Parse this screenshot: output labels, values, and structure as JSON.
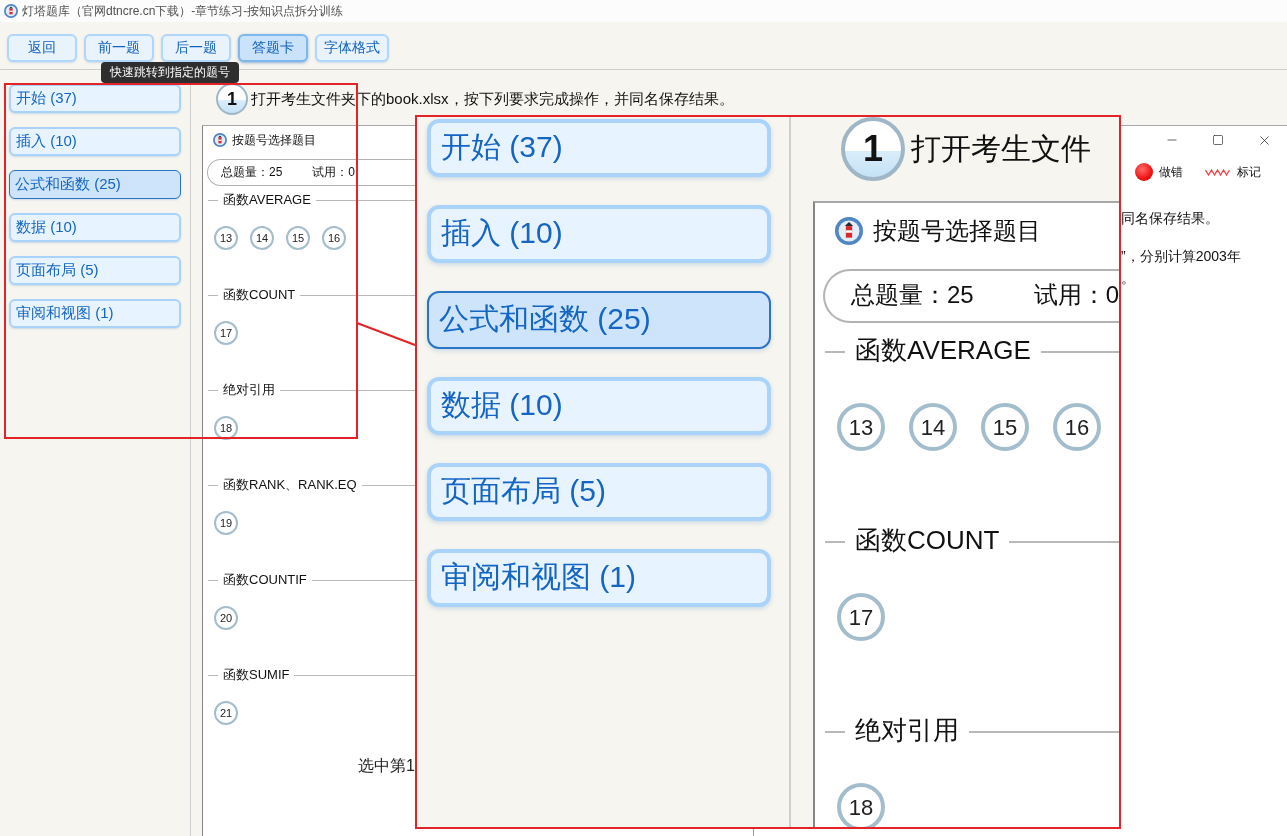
{
  "window": {
    "title": "灯塔题库（官网dtncre.cn下载）-章节练习-按知识点拆分训练"
  },
  "toolbar": {
    "buttons": [
      {
        "label": "返回",
        "selected": false
      },
      {
        "label": "前一题",
        "selected": false
      },
      {
        "label": "后一题",
        "selected": false
      },
      {
        "label": "答题卡",
        "selected": true
      },
      {
        "label": "字体格式",
        "selected": false
      }
    ],
    "tooltip": "快速跳转到指定的题号"
  },
  "sidebar": {
    "items": [
      {
        "label": "开始 (37)",
        "selected": false
      },
      {
        "label": "插入 (10)",
        "selected": false
      },
      {
        "label": "公式和函数 (25)",
        "selected": true
      },
      {
        "label": "数据 (10)",
        "selected": false
      },
      {
        "label": "页面布局 (5)",
        "selected": false
      },
      {
        "label": "审阅和视图 (1)",
        "selected": false
      }
    ]
  },
  "question": {
    "number": "1",
    "text": "打开考生文件夹下的book.xlsx，按下列要求完成操作，并同名保存结果。"
  },
  "answer_card": {
    "title": "按题号选择题目",
    "stats": [
      "总题量：25",
      "试用：0"
    ],
    "legend": [
      {
        "kind": "dot",
        "label": "做错"
      },
      {
        "kind": "wave",
        "label": "标记"
      }
    ],
    "sections": [
      {
        "title": "函数AVERAGE",
        "numbers": [
          "13",
          "14",
          "15",
          "16"
        ]
      },
      {
        "title": "函数COUNT",
        "numbers": [
          "17"
        ]
      },
      {
        "title": "绝对引用",
        "numbers": [
          "18"
        ]
      },
      {
        "title": "函数RANK、RANK.EQ",
        "numbers": [
          "19"
        ]
      },
      {
        "title": "函数COUNTIF",
        "numbers": [
          "20"
        ]
      },
      {
        "title": "函数SUMIF",
        "numbers": [
          "21"
        ]
      }
    ],
    "footer": "选中第1",
    "side_text": [
      {
        "lines": [
          "同名保存结果。"
        ]
      },
      {
        "lines": [
          "”，分别计算2003年",
          "。"
        ]
      }
    ]
  },
  "magnifier": {
    "sidebar_items": [
      {
        "label": "开始 (37)",
        "selected": false
      },
      {
        "label": "插入 (10)",
        "selected": false
      },
      {
        "label": "公式和函数 (25)",
        "selected": true
      },
      {
        "label": "数据 (10)",
        "selected": false
      },
      {
        "label": "页面布局 (5)",
        "selected": false
      },
      {
        "label": "审阅和视图 (1)",
        "selected": false
      }
    ],
    "question": {
      "number": "1",
      "text": "打开考生文件"
    },
    "answer_card": {
      "title": "按题号选择题目",
      "stats": [
        "总题量：25",
        "试用：0"
      ],
      "sections": [
        {
          "title": "函数AVERAGE",
          "numbers": [
            "13",
            "14",
            "15",
            "16"
          ]
        },
        {
          "title": "函数COUNT",
          "numbers": [
            "17"
          ]
        },
        {
          "title": "绝对引用",
          "numbers": [
            "18"
          ]
        }
      ]
    }
  }
}
